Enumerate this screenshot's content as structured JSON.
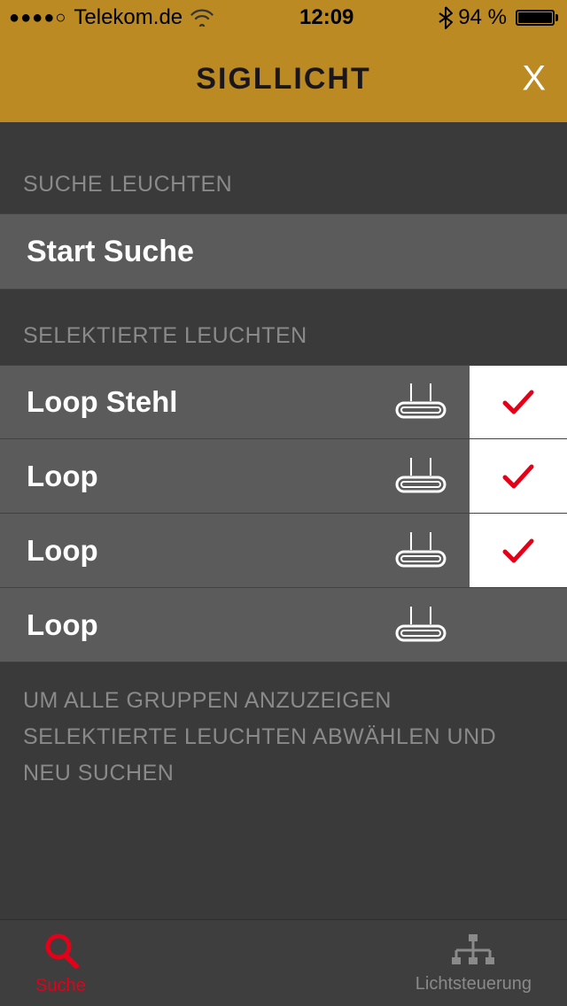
{
  "status": {
    "carrier": "Telekom.de",
    "time": "12:09",
    "battery_text": "94 %"
  },
  "header": {
    "title": "SIGLLICHT",
    "close": "X"
  },
  "sections": {
    "search_label": "SUCHE LEUCHTEN",
    "start_button": "Start Suche",
    "selected_label": "SELEKTIERTE LEUCHTEN"
  },
  "lights": [
    {
      "name": "Loop Stehl",
      "checked": true
    },
    {
      "name": "Loop",
      "checked": true
    },
    {
      "name": "Loop",
      "checked": true
    },
    {
      "name": "Loop",
      "checked": false
    }
  ],
  "footer_note": {
    "line1": "UM ALLE GRUPPEN ANZUZEIGEN",
    "line2": "SELEKTIERTE LEUCHTEN ABWÄHLEN UND",
    "line3": "NEU SUCHEN"
  },
  "tabs": {
    "search": "Suche",
    "control": "Lichtsteuerung"
  },
  "colors": {
    "accent": "#bb8a22",
    "check": "#e30018"
  }
}
